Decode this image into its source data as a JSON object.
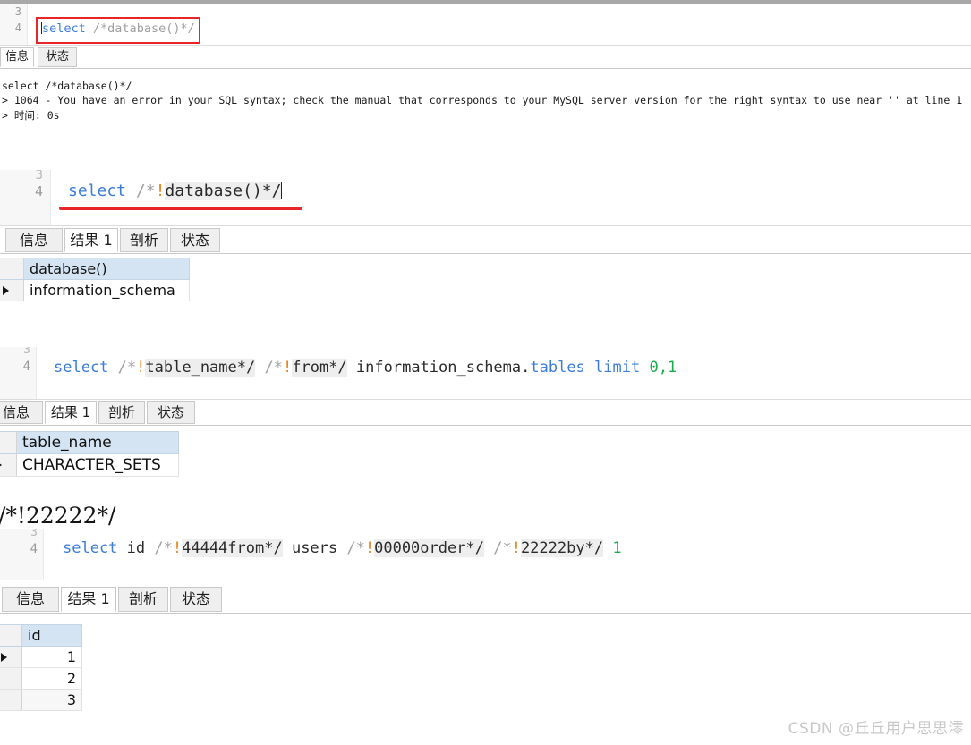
{
  "watermark": "CSDN @丘丘用户思思澪",
  "colors": {
    "annotation_red": "#e8262a",
    "keyword_blue": "#3b7dd8",
    "number_green": "#1aab4b",
    "comment_gray": "#a0a0a0",
    "bang_orange": "#e8821a",
    "grid_header_blue": "#d4e4f3"
  },
  "panels": [
    {
      "id": "panel-1",
      "editor": {
        "line_numbers": [
          "3",
          "4"
        ],
        "query_plain": "select /*database()*/",
        "tokens": [
          {
            "text": "select",
            "kind": "keyword"
          },
          {
            "text": " ",
            "kind": "plain"
          },
          {
            "text": "/*database()*/",
            "kind": "comment"
          }
        ],
        "annotation": "red-rectangle-around-query"
      },
      "tabs": [
        {
          "label": "信息",
          "active": true
        },
        {
          "label": "状态",
          "active": false
        }
      ],
      "console_lines": [
        "select /*database()*/",
        "> 1064 - You have an error in your SQL syntax; check the manual that corresponds to your MySQL server version for the right syntax to use near '' at line 1",
        "> 时间: 0s"
      ]
    },
    {
      "id": "panel-2",
      "editor": {
        "line_numbers": [
          "3",
          "4"
        ],
        "query_plain": "select /*!database()*/",
        "tokens": [
          {
            "text": "select",
            "kind": "keyword"
          },
          {
            "text": " ",
            "kind": "plain"
          },
          {
            "text": "/*",
            "kind": "comment"
          },
          {
            "text": "!",
            "kind": "bang"
          },
          {
            "text": "database()",
            "kind": "inline"
          },
          {
            "text": "*/",
            "kind": "comment"
          }
        ],
        "annotation": "red-underline-under-query"
      },
      "tabs": [
        {
          "label": "信息",
          "active": false
        },
        {
          "label": "结果 1",
          "active": true
        },
        {
          "label": "剖析",
          "active": false
        },
        {
          "label": "状态",
          "active": false
        }
      ],
      "grid": {
        "columns": [
          "database()"
        ],
        "rows": [
          {
            "marked": true,
            "cells": [
              "information_schema"
            ]
          }
        ]
      }
    },
    {
      "id": "panel-3",
      "editor": {
        "line_numbers": [
          "3",
          "4"
        ],
        "query_plain": "select /*!table_name*/ /*!from*/ information_schema.tables limit 0,1",
        "tokens": [
          {
            "text": "select",
            "kind": "keyword"
          },
          {
            "text": " ",
            "kind": "plain"
          },
          {
            "text": "/*",
            "kind": "comment"
          },
          {
            "text": "!",
            "kind": "bang"
          },
          {
            "text": "table_name",
            "kind": "inline"
          },
          {
            "text": "*/",
            "kind": "comment"
          },
          {
            "text": " ",
            "kind": "plain"
          },
          {
            "text": "/*",
            "kind": "comment"
          },
          {
            "text": "!",
            "kind": "bang"
          },
          {
            "text": "from",
            "kind": "inline"
          },
          {
            "text": "*/",
            "kind": "comment"
          },
          {
            "text": " information_schema.",
            "kind": "plain"
          },
          {
            "text": "tables",
            "kind": "keyword"
          },
          {
            "text": " ",
            "kind": "plain"
          },
          {
            "text": "limit",
            "kind": "keyword"
          },
          {
            "text": " ",
            "kind": "plain"
          },
          {
            "text": "0,1",
            "kind": "number"
          }
        ]
      },
      "tabs": [
        {
          "label": "信息",
          "active": false
        },
        {
          "label": "结果 1",
          "active": true
        },
        {
          "label": "剖析",
          "active": false
        },
        {
          "label": "状态",
          "active": false
        }
      ],
      "grid": {
        "columns": [
          "table_name"
        ],
        "rows": [
          {
            "marked": true,
            "cells": [
              "CHARACTER_SETS"
            ]
          }
        ]
      }
    },
    {
      "id": "panel-4",
      "note": "/*!22222*/",
      "editor": {
        "line_numbers": [
          "3",
          "4"
        ],
        "query_plain": "select id /*!44444from*/ users /*!00000order*/ /*!22222by*/ 1",
        "tokens": [
          {
            "text": "select",
            "kind": "keyword"
          },
          {
            "text": " id ",
            "kind": "plain"
          },
          {
            "text": "/*",
            "kind": "comment"
          },
          {
            "text": "!",
            "kind": "bang"
          },
          {
            "text": "44444from",
            "kind": "inline"
          },
          {
            "text": "*/",
            "kind": "comment"
          },
          {
            "text": " users ",
            "kind": "plain"
          },
          {
            "text": "/*",
            "kind": "comment"
          },
          {
            "text": "!",
            "kind": "bang"
          },
          {
            "text": "00000order",
            "kind": "inline"
          },
          {
            "text": "*/",
            "kind": "comment"
          },
          {
            "text": " ",
            "kind": "plain"
          },
          {
            "text": "/*",
            "kind": "comment"
          },
          {
            "text": "!",
            "kind": "bang"
          },
          {
            "text": "22222by",
            "kind": "inline"
          },
          {
            "text": "*/",
            "kind": "comment"
          },
          {
            "text": " ",
            "kind": "plain"
          },
          {
            "text": "1",
            "kind": "number"
          }
        ]
      },
      "tabs": [
        {
          "label": "信息",
          "active": false
        },
        {
          "label": "结果 1",
          "active": true
        },
        {
          "label": "剖析",
          "active": false
        },
        {
          "label": "状态",
          "active": false
        }
      ],
      "grid": {
        "columns": [
          "id"
        ],
        "rows": [
          {
            "marked": true,
            "cells": [
              "1"
            ]
          },
          {
            "marked": false,
            "cells": [
              "2"
            ]
          },
          {
            "marked": false,
            "cells": [
              "3"
            ]
          }
        ]
      }
    }
  ]
}
